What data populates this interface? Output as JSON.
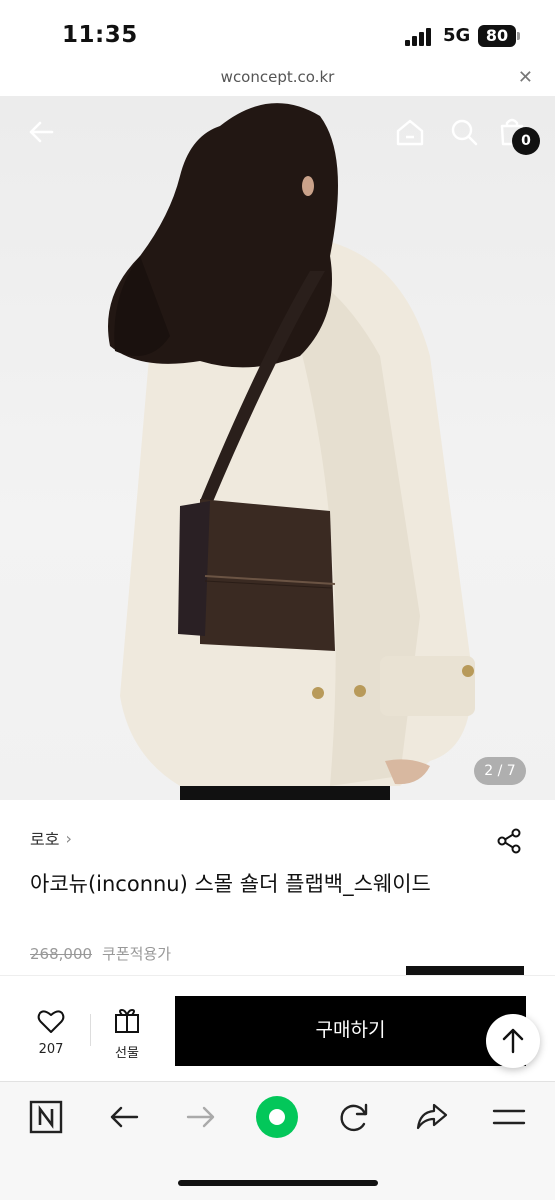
{
  "status_bar": {
    "time": "11:35",
    "network": "5G",
    "battery": "80"
  },
  "browser": {
    "url": "wconcept.co.kr",
    "close_icon": "close-icon"
  },
  "product_gallery": {
    "page_indicator": "2 / 7",
    "cart_count": "0",
    "icons": [
      "back-arrow-icon",
      "home-icon",
      "search-icon",
      "shopping-bag-icon"
    ]
  },
  "product": {
    "brand": "로호",
    "title": "아코뉴(inconnu) 스몰 숄더 플랩백_스웨이드",
    "original_price": "268,000",
    "coupon_label": "쿠폰적용가"
  },
  "action_bar": {
    "like_count": "207",
    "gift_label": "선물",
    "buy_label": "구매하기"
  },
  "toolbar": {
    "icons": [
      "naver-n-icon",
      "back-icon",
      "forward-icon",
      "green-dot-icon",
      "refresh-icon",
      "share-icon",
      "menu-icon"
    ]
  },
  "colors": {
    "accent_black": "#000000",
    "naver_green": "#03c75a",
    "bag_brown": "#3a2a22"
  }
}
